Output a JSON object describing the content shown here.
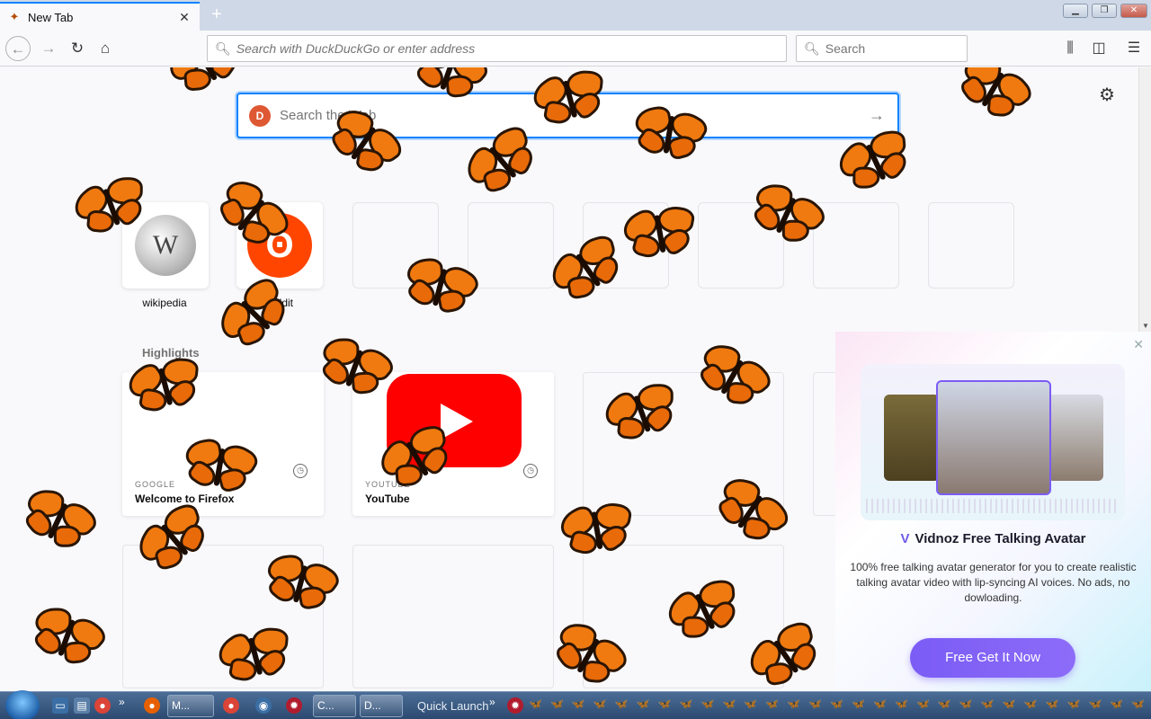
{
  "browser": {
    "tab_title": "New Tab",
    "new_tab_symbol": "+",
    "url_placeholder": "Search with DuckDuckGo or enter address",
    "search_placeholder": "Search"
  },
  "newtab": {
    "ddg_search_placeholder": "Search the Web",
    "top_sites": [
      {
        "label": "wikipedia"
      },
      {
        "label": "reddit"
      }
    ],
    "highlights_title": "Highlights",
    "highlights": [
      {
        "source": "GOOGLE",
        "title": "Welcome to Firefox"
      },
      {
        "source": "YOUTUBE",
        "title": "YouTube"
      }
    ]
  },
  "ad": {
    "brand": "Vidnoz Free Talking Avatar",
    "description": "100% free talking avatar generator for you to create realistic talking avatar video with lip-syncing AI voices. No ads, no dowloading.",
    "cta": "Free Get It Now"
  },
  "taskbar": {
    "tasks": [
      {
        "label": "M..."
      },
      {
        "label": "C..."
      },
      {
        "label": "D..."
      }
    ],
    "quick_launch": "Quick Launch",
    "chevron": "»"
  },
  "colors": {
    "accent": "#0a84ff",
    "butterfly_orange": "#f07a10",
    "ad_button": "#7b5cf5",
    "youtube_red": "#ff0000",
    "reddit_orange": "#ff4500"
  }
}
